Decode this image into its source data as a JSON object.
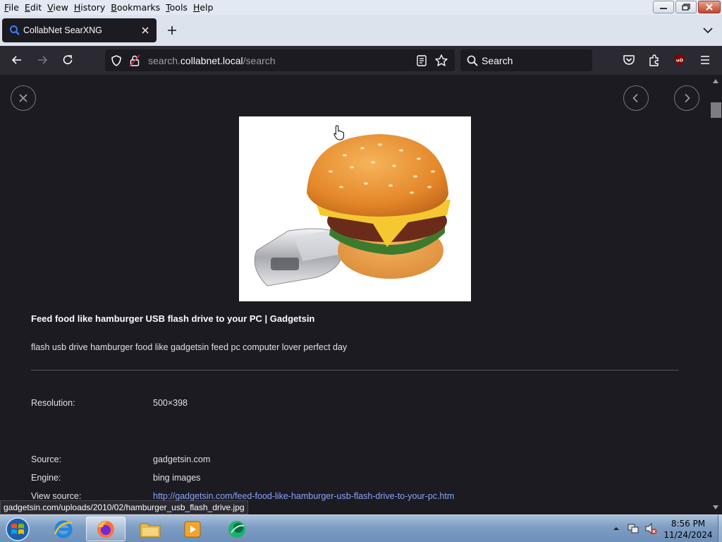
{
  "menu": {
    "items": [
      "File",
      "Edit",
      "View",
      "History",
      "Bookmarks",
      "Tools",
      "Help"
    ],
    "underline": [
      "F",
      "E",
      "V",
      "H",
      "B",
      "T",
      "H"
    ]
  },
  "tab": {
    "title": "CollabNet SearXNG"
  },
  "urlbar": {
    "prefix": "search.",
    "domain": "collabnet.local",
    "path": "/search"
  },
  "searchbar": {
    "placeholder": "Search"
  },
  "result": {
    "title": "Feed food like hamburger USB flash drive to your PC | Gadgetsin",
    "description": "flash usb drive hamburger food like gadgetsin feed pc computer lover perfect day",
    "fields": [
      {
        "label": "Resolution:",
        "value": "500×398"
      },
      {
        "label": "Source:",
        "value": "gadgetsin.com"
      },
      {
        "label": "Engine:",
        "value": "bing images"
      },
      {
        "label": "View source:",
        "value": "http://gadgetsin.com/feed-food-like-hamburger-usb-flash-drive-to-your-pc.htm"
      }
    ]
  },
  "status": {
    "text": "gadgetsin.com/uploads/2010/02/hamburger_usb_flash_drive.jpg"
  },
  "taskbar": {
    "time": "8:56 PM",
    "date": "11/24/2024"
  },
  "colors": {
    "page_bg": "#1c1b22",
    "toolbar_bg": "#2b2a33",
    "link": "#8aa4f5",
    "ublock": "#800000"
  }
}
